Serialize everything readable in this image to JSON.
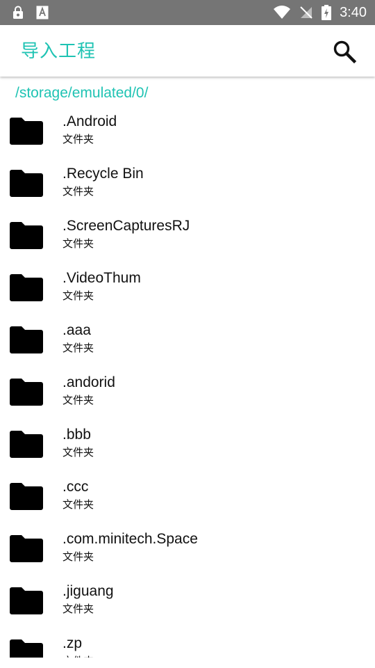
{
  "status_bar": {
    "time": "3:40",
    "icons": [
      "lock-icon",
      "font-a-icon",
      "wifi-icon",
      "no-sim-icon",
      "battery-charging-icon"
    ]
  },
  "app_bar": {
    "title": "导入工程",
    "search_icon": "search-icon"
  },
  "current_path": "/storage/emulated/0/",
  "colors": {
    "accent": "#1fc3b3",
    "status_bar": "#757575",
    "text": "#111111"
  },
  "files": [
    {
      "name": ".Android",
      "type": "文件夹"
    },
    {
      "name": ".Recycle Bin",
      "type": "文件夹"
    },
    {
      "name": ".ScreenCapturesRJ",
      "type": "文件夹"
    },
    {
      "name": ".VideoThum",
      "type": "文件夹"
    },
    {
      "name": ".aaa",
      "type": "文件夹"
    },
    {
      "name": ".andorid",
      "type": "文件夹"
    },
    {
      "name": ".bbb",
      "type": "文件夹"
    },
    {
      "name": ".ccc",
      "type": "文件夹"
    },
    {
      "name": ".com.minitech.Space",
      "type": "文件夹"
    },
    {
      "name": ".jiguang",
      "type": "文件夹"
    },
    {
      "name": ".zp",
      "type": "文件夹"
    }
  ]
}
